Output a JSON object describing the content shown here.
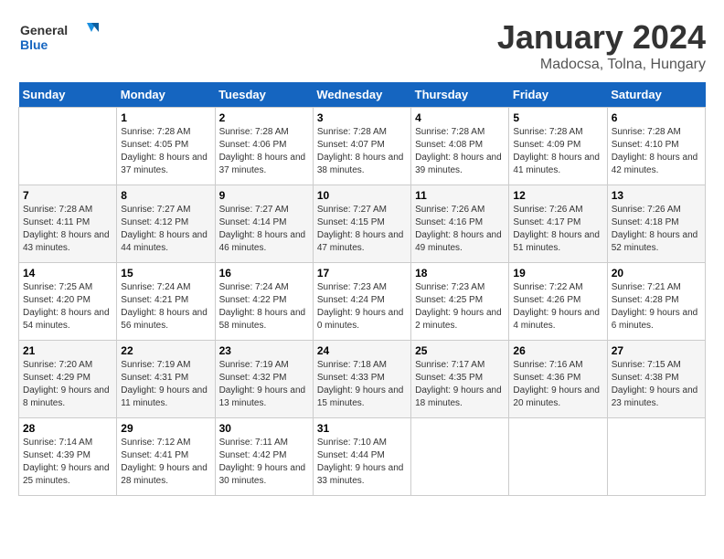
{
  "header": {
    "logo_line1": "General",
    "logo_line2": "Blue",
    "month_title": "January 2024",
    "location": "Madocsa, Tolna, Hungary"
  },
  "days_of_week": [
    "Sunday",
    "Monday",
    "Tuesday",
    "Wednesday",
    "Thursday",
    "Friday",
    "Saturday"
  ],
  "weeks": [
    [
      {
        "num": "",
        "sunrise": "",
        "sunset": "",
        "daylight": ""
      },
      {
        "num": "1",
        "sunrise": "Sunrise: 7:28 AM",
        "sunset": "Sunset: 4:05 PM",
        "daylight": "Daylight: 8 hours and 37 minutes."
      },
      {
        "num": "2",
        "sunrise": "Sunrise: 7:28 AM",
        "sunset": "Sunset: 4:06 PM",
        "daylight": "Daylight: 8 hours and 37 minutes."
      },
      {
        "num": "3",
        "sunrise": "Sunrise: 7:28 AM",
        "sunset": "Sunset: 4:07 PM",
        "daylight": "Daylight: 8 hours and 38 minutes."
      },
      {
        "num": "4",
        "sunrise": "Sunrise: 7:28 AM",
        "sunset": "Sunset: 4:08 PM",
        "daylight": "Daylight: 8 hours and 39 minutes."
      },
      {
        "num": "5",
        "sunrise": "Sunrise: 7:28 AM",
        "sunset": "Sunset: 4:09 PM",
        "daylight": "Daylight: 8 hours and 41 minutes."
      },
      {
        "num": "6",
        "sunrise": "Sunrise: 7:28 AM",
        "sunset": "Sunset: 4:10 PM",
        "daylight": "Daylight: 8 hours and 42 minutes."
      }
    ],
    [
      {
        "num": "7",
        "sunrise": "Sunrise: 7:28 AM",
        "sunset": "Sunset: 4:11 PM",
        "daylight": "Daylight: 8 hours and 43 minutes."
      },
      {
        "num": "8",
        "sunrise": "Sunrise: 7:27 AM",
        "sunset": "Sunset: 4:12 PM",
        "daylight": "Daylight: 8 hours and 44 minutes."
      },
      {
        "num": "9",
        "sunrise": "Sunrise: 7:27 AM",
        "sunset": "Sunset: 4:14 PM",
        "daylight": "Daylight: 8 hours and 46 minutes."
      },
      {
        "num": "10",
        "sunrise": "Sunrise: 7:27 AM",
        "sunset": "Sunset: 4:15 PM",
        "daylight": "Daylight: 8 hours and 47 minutes."
      },
      {
        "num": "11",
        "sunrise": "Sunrise: 7:26 AM",
        "sunset": "Sunset: 4:16 PM",
        "daylight": "Daylight: 8 hours and 49 minutes."
      },
      {
        "num": "12",
        "sunrise": "Sunrise: 7:26 AM",
        "sunset": "Sunset: 4:17 PM",
        "daylight": "Daylight: 8 hours and 51 minutes."
      },
      {
        "num": "13",
        "sunrise": "Sunrise: 7:26 AM",
        "sunset": "Sunset: 4:18 PM",
        "daylight": "Daylight: 8 hours and 52 minutes."
      }
    ],
    [
      {
        "num": "14",
        "sunrise": "Sunrise: 7:25 AM",
        "sunset": "Sunset: 4:20 PM",
        "daylight": "Daylight: 8 hours and 54 minutes."
      },
      {
        "num": "15",
        "sunrise": "Sunrise: 7:24 AM",
        "sunset": "Sunset: 4:21 PM",
        "daylight": "Daylight: 8 hours and 56 minutes."
      },
      {
        "num": "16",
        "sunrise": "Sunrise: 7:24 AM",
        "sunset": "Sunset: 4:22 PM",
        "daylight": "Daylight: 8 hours and 58 minutes."
      },
      {
        "num": "17",
        "sunrise": "Sunrise: 7:23 AM",
        "sunset": "Sunset: 4:24 PM",
        "daylight": "Daylight: 9 hours and 0 minutes."
      },
      {
        "num": "18",
        "sunrise": "Sunrise: 7:23 AM",
        "sunset": "Sunset: 4:25 PM",
        "daylight": "Daylight: 9 hours and 2 minutes."
      },
      {
        "num": "19",
        "sunrise": "Sunrise: 7:22 AM",
        "sunset": "Sunset: 4:26 PM",
        "daylight": "Daylight: 9 hours and 4 minutes."
      },
      {
        "num": "20",
        "sunrise": "Sunrise: 7:21 AM",
        "sunset": "Sunset: 4:28 PM",
        "daylight": "Daylight: 9 hours and 6 minutes."
      }
    ],
    [
      {
        "num": "21",
        "sunrise": "Sunrise: 7:20 AM",
        "sunset": "Sunset: 4:29 PM",
        "daylight": "Daylight: 9 hours and 8 minutes."
      },
      {
        "num": "22",
        "sunrise": "Sunrise: 7:19 AM",
        "sunset": "Sunset: 4:31 PM",
        "daylight": "Daylight: 9 hours and 11 minutes."
      },
      {
        "num": "23",
        "sunrise": "Sunrise: 7:19 AM",
        "sunset": "Sunset: 4:32 PM",
        "daylight": "Daylight: 9 hours and 13 minutes."
      },
      {
        "num": "24",
        "sunrise": "Sunrise: 7:18 AM",
        "sunset": "Sunset: 4:33 PM",
        "daylight": "Daylight: 9 hours and 15 minutes."
      },
      {
        "num": "25",
        "sunrise": "Sunrise: 7:17 AM",
        "sunset": "Sunset: 4:35 PM",
        "daylight": "Daylight: 9 hours and 18 minutes."
      },
      {
        "num": "26",
        "sunrise": "Sunrise: 7:16 AM",
        "sunset": "Sunset: 4:36 PM",
        "daylight": "Daylight: 9 hours and 20 minutes."
      },
      {
        "num": "27",
        "sunrise": "Sunrise: 7:15 AM",
        "sunset": "Sunset: 4:38 PM",
        "daylight": "Daylight: 9 hours and 23 minutes."
      }
    ],
    [
      {
        "num": "28",
        "sunrise": "Sunrise: 7:14 AM",
        "sunset": "Sunset: 4:39 PM",
        "daylight": "Daylight: 9 hours and 25 minutes."
      },
      {
        "num": "29",
        "sunrise": "Sunrise: 7:12 AM",
        "sunset": "Sunset: 4:41 PM",
        "daylight": "Daylight: 9 hours and 28 minutes."
      },
      {
        "num": "30",
        "sunrise": "Sunrise: 7:11 AM",
        "sunset": "Sunset: 4:42 PM",
        "daylight": "Daylight: 9 hours and 30 minutes."
      },
      {
        "num": "31",
        "sunrise": "Sunrise: 7:10 AM",
        "sunset": "Sunset: 4:44 PM",
        "daylight": "Daylight: 9 hours and 33 minutes."
      },
      {
        "num": "",
        "sunrise": "",
        "sunset": "",
        "daylight": ""
      },
      {
        "num": "",
        "sunrise": "",
        "sunset": "",
        "daylight": ""
      },
      {
        "num": "",
        "sunrise": "",
        "sunset": "",
        "daylight": ""
      }
    ]
  ]
}
